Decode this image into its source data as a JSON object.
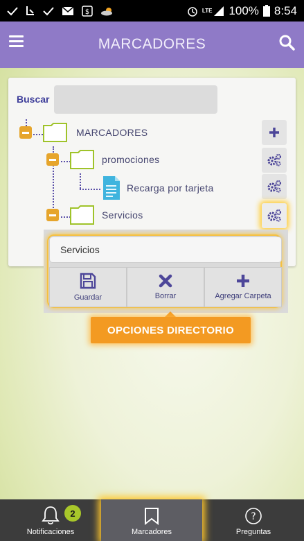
{
  "status_bar": {
    "battery": "100%",
    "time": "8:54",
    "network": "LTE"
  },
  "app_bar": {
    "title": "MARCADORES"
  },
  "search": {
    "label": "Buscar",
    "value": ""
  },
  "tree": {
    "root": {
      "label": "MARCADORES"
    },
    "child1": {
      "label": "promociones"
    },
    "child1_item": {
      "label": "Recarga por tarjeta"
    },
    "child2": {
      "label": "Servicios"
    }
  },
  "editor": {
    "name_value": "Servicios",
    "save_label": "Guardar",
    "delete_label": "Borrar",
    "add_folder_label": "Agregar Carpeta"
  },
  "callout": {
    "text": "OPCIONES DIRECTORIO"
  },
  "bottom_nav": {
    "notifications_label": "Notificaciones",
    "notifications_count": "2",
    "bookmarks_label": "Marcadores",
    "questions_label": "Preguntas"
  },
  "colors": {
    "app_bar": "#8f7ac7",
    "toggle": "#e6a52c",
    "folder_outline": "#9fc32a",
    "accent_text": "#3e3e9a",
    "highlight": "#ffc72c",
    "badge": "#a8c72a"
  },
  "icons": {
    "status_left": [
      "check-icon",
      "download-icon",
      "check-icon",
      "mail-icon",
      "dollar-icon",
      "weather-icon"
    ],
    "status_right": [
      "alarm-icon",
      "signal-icon",
      "battery-icon"
    ],
    "tree_doc": "document-icon",
    "side_buttons": [
      "plus-icon",
      "gears-icon",
      "gears-icon",
      "gears-icon"
    ]
  }
}
